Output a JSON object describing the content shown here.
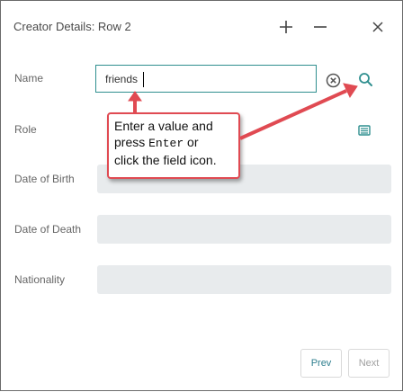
{
  "window": {
    "title": "Creator Details: Row 2",
    "buttons": [
      "plus-icon",
      "minus-icon",
      "close-icon"
    ]
  },
  "form": {
    "name": {
      "label": "Name",
      "value": "friends"
    },
    "role": {
      "label": "Role",
      "value": ""
    },
    "date_of_birth": {
      "label": "Date of Birth",
      "value": ""
    },
    "date_of_death": {
      "label": "Date of Death",
      "value": ""
    },
    "nationality": {
      "label": "Nationality",
      "value": ""
    }
  },
  "callout": {
    "line1": "Enter a value and",
    "line2_pre": "press ",
    "line2_key": "Enter",
    "line2_post": " or",
    "line3": "click the field icon."
  },
  "footer": {
    "prev_label": "Prev",
    "next_label": "Next"
  },
  "colors": {
    "accent": "#2f8f8f",
    "callout_border": "#e04a52",
    "field_bg": "#e8ebed"
  }
}
